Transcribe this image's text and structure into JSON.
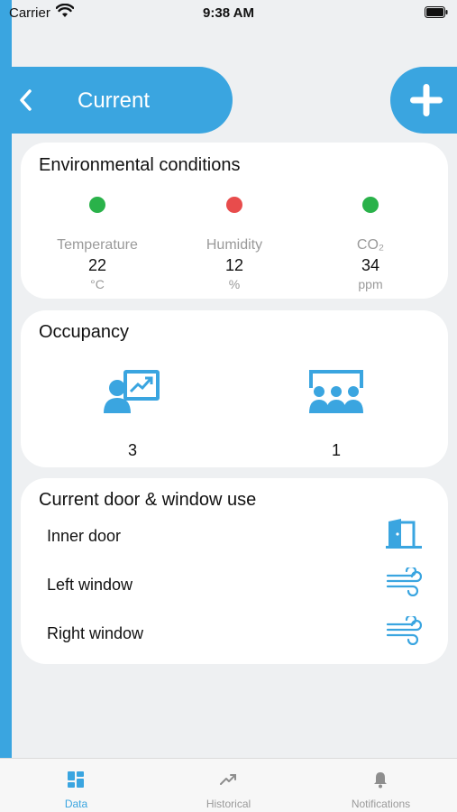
{
  "status_bar": {
    "carrier": "Carrier",
    "time": "9:38 AM"
  },
  "header": {
    "title": "Current",
    "back_icon": "chevron-left-icon",
    "add_icon": "plus-icon"
  },
  "environment": {
    "title": "Environmental conditions",
    "metrics": [
      {
        "label": "Temperature",
        "value": "22",
        "unit": "°C",
        "status_color": "#2ab24a"
      },
      {
        "label": "Humidity",
        "value": "12",
        "unit": "%",
        "status_color": "#e84c4c"
      },
      {
        "label": "CO₂",
        "value": "34",
        "unit": "ppm",
        "status_color": "#2ab24a"
      }
    ]
  },
  "occupancy": {
    "title": "Occupancy",
    "items": [
      {
        "icon": "presenter-icon",
        "count": "3"
      },
      {
        "icon": "audience-icon",
        "count": "1"
      }
    ]
  },
  "doors_windows": {
    "title": "Current door & window use",
    "rows": [
      {
        "label": "Inner door",
        "icon": "door-open-icon"
      },
      {
        "label": "Left window",
        "icon": "wind-icon"
      },
      {
        "label": "Right window",
        "icon": "wind-icon"
      }
    ]
  },
  "tabs": [
    {
      "label": "Data",
      "icon": "dashboard-icon",
      "active": true
    },
    {
      "label": "Historical",
      "icon": "trend-icon",
      "active": false
    },
    {
      "label": "Notifications",
      "icon": "bell-icon",
      "active": false
    }
  ],
  "colors": {
    "accent": "#3aa5e0",
    "ok": "#2ab24a",
    "alert": "#e84c4c",
    "background": "#eef0f2"
  }
}
